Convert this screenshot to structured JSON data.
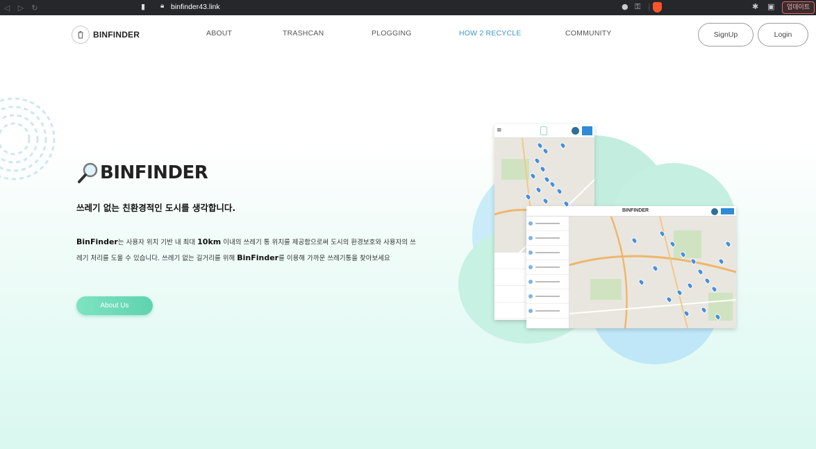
{
  "browser": {
    "url": "binfinder43.link",
    "update_label": "업데이트"
  },
  "header": {
    "logo_text": "BINFINDER",
    "nav": [
      "ABOUT",
      "TRASHCAN",
      "PLOGGING",
      "HOW 2 RECYCLE",
      "COMMUNITY"
    ],
    "active_nav": "HOW 2 RECYCLE",
    "signup_label": "SignUp",
    "login_label": "Login"
  },
  "hero": {
    "title": "BINFINDER",
    "subtitle": "쓰레기 없는 친환경적인 도시를 생각합니다.",
    "desc_parts": {
      "brand1": "BinFinder",
      "t1": "는 사용자 위치 기반 내 최대 ",
      "km": "10km",
      "t2": " 이내의 쓰레기 통 위치를 제공함으로써 도시의 환경보호와 사용자의 쓰레기 처리를 도울 수 있습니다. 쓰레기 없는 길거리를 위해 ",
      "brand2": "BinFinder",
      "t3": "를 이용해 가까운 쓰레기통을 찾아보세요"
    },
    "about_button": "About Us"
  },
  "illustration": {
    "back_screen_logo": "BINFINDER",
    "colors": {
      "blob_blue": "#bfe7f7",
      "blob_green": "#c7f1e2",
      "pin": "#4a8fd8",
      "accent": "#3c97c9"
    }
  }
}
